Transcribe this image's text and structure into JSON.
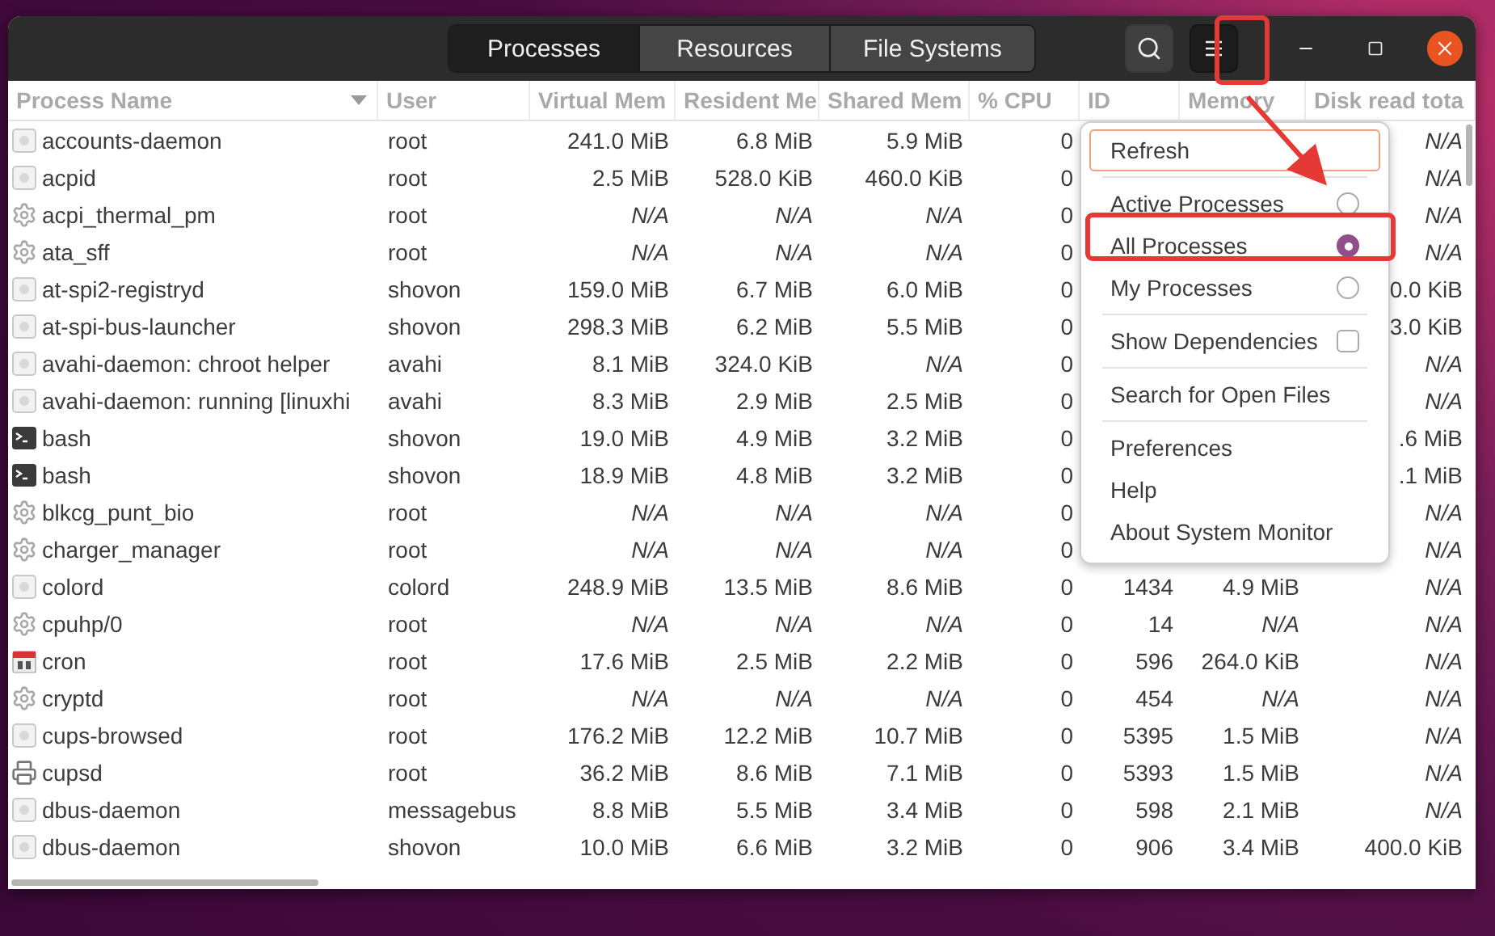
{
  "tabs": [
    {
      "label": "Processes",
      "selected": true
    },
    {
      "label": "Resources",
      "selected": false
    },
    {
      "label": "File Systems",
      "selected": false
    }
  ],
  "header_buttons": [
    {
      "kind": "search",
      "active": false
    },
    {
      "kind": "menu",
      "active": true
    }
  ],
  "columns": [
    {
      "label": "Process Name",
      "sorted": true
    },
    {
      "label": "User",
      "sorted": false
    },
    {
      "label": "Virtual Mem",
      "sorted": false
    },
    {
      "label": "Resident Me",
      "sorted": false
    },
    {
      "label": "Shared Mem",
      "sorted": false
    },
    {
      "label": "% CPU",
      "sorted": false
    },
    {
      "label": "ID",
      "sorted": false
    },
    {
      "label": "Memory",
      "sorted": false
    },
    {
      "label": "Disk read tota",
      "sorted": false
    }
  ],
  "rows": [
    {
      "kind": "generic",
      "name": "accounts-daemon",
      "user": "root",
      "values": [
        {
          "text": "241.0 MiB",
          "italic": false
        },
        {
          "text": "6.8 MiB",
          "italic": false
        },
        {
          "text": "5.9 MiB",
          "italic": false
        },
        {
          "text": "0",
          "italic": false
        }
      ],
      "disk_read": {
        "text": "N/A",
        "italic": true
      }
    },
    {
      "kind": "generic",
      "name": "acpid",
      "user": "root",
      "values": [
        {
          "text": "2.5 MiB",
          "italic": false
        },
        {
          "text": "528.0 KiB",
          "italic": false
        },
        {
          "text": "460.0 KiB",
          "italic": false
        },
        {
          "text": "0",
          "italic": false
        }
      ],
      "disk_read": {
        "text": "N/A",
        "italic": true
      }
    },
    {
      "kind": "gear",
      "name": "acpi_thermal_pm",
      "user": "root",
      "values": [
        {
          "text": "N/A",
          "italic": true
        },
        {
          "text": "N/A",
          "italic": true
        },
        {
          "text": "N/A",
          "italic": true
        },
        {
          "text": "0",
          "italic": false
        }
      ],
      "disk_read": {
        "text": "N/A",
        "italic": true
      }
    },
    {
      "kind": "gear",
      "name": "ata_sff",
      "user": "root",
      "values": [
        {
          "text": "N/A",
          "italic": true
        },
        {
          "text": "N/A",
          "italic": true
        },
        {
          "text": "N/A",
          "italic": true
        },
        {
          "text": "0",
          "italic": false
        }
      ],
      "disk_read": {
        "text": "N/A",
        "italic": true
      }
    },
    {
      "kind": "generic",
      "name": "at-spi2-registryd",
      "user": "shovon",
      "values": [
        {
          "text": "159.0 MiB",
          "italic": false
        },
        {
          "text": "6.7 MiB",
          "italic": false
        },
        {
          "text": "6.0 MiB",
          "italic": false
        },
        {
          "text": "0",
          "italic": false
        }
      ],
      "disk_read": {
        "text": "0.0 KiB",
        "italic": false
      }
    },
    {
      "kind": "generic",
      "name": "at-spi-bus-launcher",
      "user": "shovon",
      "values": [
        {
          "text": "298.3 MiB",
          "italic": false
        },
        {
          "text": "6.2 MiB",
          "italic": false
        },
        {
          "text": "5.5 MiB",
          "italic": false
        },
        {
          "text": "0",
          "italic": false
        }
      ],
      "disk_read": {
        "text": "3.0 KiB",
        "italic": false
      }
    },
    {
      "kind": "generic",
      "name": "avahi-daemon: chroot helper",
      "user": "avahi",
      "values": [
        {
          "text": "8.1 MiB",
          "italic": false
        },
        {
          "text": "324.0 KiB",
          "italic": false
        },
        {
          "text": "N/A",
          "italic": true
        },
        {
          "text": "0",
          "italic": false
        }
      ],
      "disk_read": {
        "text": "N/A",
        "italic": true
      }
    },
    {
      "kind": "generic",
      "name": "avahi-daemon: running [linuxhi",
      "user": "avahi",
      "values": [
        {
          "text": "8.3 MiB",
          "italic": false
        },
        {
          "text": "2.9 MiB",
          "italic": false
        },
        {
          "text": "2.5 MiB",
          "italic": false
        },
        {
          "text": "0",
          "italic": false
        }
      ],
      "disk_read": {
        "text": "N/A",
        "italic": true
      }
    },
    {
      "kind": "terminal",
      "name": "bash",
      "user": "shovon",
      "values": [
        {
          "text": "19.0 MiB",
          "italic": false
        },
        {
          "text": "4.9 MiB",
          "italic": false
        },
        {
          "text": "3.2 MiB",
          "italic": false
        },
        {
          "text": "0",
          "italic": false
        }
      ],
      "disk_read": {
        "text": ".6 MiB",
        "italic": false
      }
    },
    {
      "kind": "terminal",
      "name": "bash",
      "user": "shovon",
      "values": [
        {
          "text": "18.9 MiB",
          "italic": false
        },
        {
          "text": "4.8 MiB",
          "italic": false
        },
        {
          "text": "3.2 MiB",
          "italic": false
        },
        {
          "text": "0",
          "italic": false
        }
      ],
      "disk_read": {
        "text": ".1 MiB",
        "italic": false
      }
    },
    {
      "kind": "gear",
      "name": "blkcg_punt_bio",
      "user": "root",
      "values": [
        {
          "text": "N/A",
          "italic": true
        },
        {
          "text": "N/A",
          "italic": true
        },
        {
          "text": "N/A",
          "italic": true
        },
        {
          "text": "0",
          "italic": false
        }
      ],
      "disk_read": {
        "text": "N/A",
        "italic": true
      }
    },
    {
      "kind": "gear",
      "name": "charger_manager",
      "user": "root",
      "values": [
        {
          "text": "N/A",
          "italic": true
        },
        {
          "text": "N/A",
          "italic": true
        },
        {
          "text": "N/A",
          "italic": true
        },
        {
          "text": "0",
          "italic": false
        }
      ],
      "disk_read": {
        "text": "N/A",
        "italic": true
      }
    },
    {
      "kind": "generic",
      "name": "colord",
      "user": "colord",
      "values": [
        {
          "text": "248.9 MiB",
          "italic": false
        },
        {
          "text": "13.5 MiB",
          "italic": false
        },
        {
          "text": "8.6 MiB",
          "italic": false
        },
        {
          "text": "0",
          "italic": false
        },
        {
          "text": "1434",
          "italic": false
        },
        {
          "text": "4.9 MiB",
          "italic": false
        }
      ],
      "disk_read": {
        "text": "N/A",
        "italic": true
      }
    },
    {
      "kind": "gear",
      "name": "cpuhp/0",
      "user": "root",
      "values": [
        {
          "text": "N/A",
          "italic": true
        },
        {
          "text": "N/A",
          "italic": true
        },
        {
          "text": "N/A",
          "italic": true
        },
        {
          "text": "0",
          "italic": false
        },
        {
          "text": "14",
          "italic": false
        },
        {
          "text": "N/A",
          "italic": true
        }
      ],
      "disk_read": {
        "text": "N/A",
        "italic": true
      }
    },
    {
      "kind": "calendar",
      "name": "cron",
      "user": "root",
      "values": [
        {
          "text": "17.6 MiB",
          "italic": false
        },
        {
          "text": "2.5 MiB",
          "italic": false
        },
        {
          "text": "2.2 MiB",
          "italic": false
        },
        {
          "text": "0",
          "italic": false
        },
        {
          "text": "596",
          "italic": false
        },
        {
          "text": "264.0 KiB",
          "italic": false
        }
      ],
      "disk_read": {
        "text": "N/A",
        "italic": true
      }
    },
    {
      "kind": "gear",
      "name": "cryptd",
      "user": "root",
      "values": [
        {
          "text": "N/A",
          "italic": true
        },
        {
          "text": "N/A",
          "italic": true
        },
        {
          "text": "N/A",
          "italic": true
        },
        {
          "text": "0",
          "italic": false
        },
        {
          "text": "454",
          "italic": false
        },
        {
          "text": "N/A",
          "italic": true
        }
      ],
      "disk_read": {
        "text": "N/A",
        "italic": true
      }
    },
    {
      "kind": "generic",
      "name": "cups-browsed",
      "user": "root",
      "values": [
        {
          "text": "176.2 MiB",
          "italic": false
        },
        {
          "text": "12.2 MiB",
          "italic": false
        },
        {
          "text": "10.7 MiB",
          "italic": false
        },
        {
          "text": "0",
          "italic": false
        },
        {
          "text": "5395",
          "italic": false
        },
        {
          "text": "1.5 MiB",
          "italic": false
        }
      ],
      "disk_read": {
        "text": "N/A",
        "italic": true
      }
    },
    {
      "kind": "printer",
      "name": "cupsd",
      "user": "root",
      "values": [
        {
          "text": "36.2 MiB",
          "italic": false
        },
        {
          "text": "8.6 MiB",
          "italic": false
        },
        {
          "text": "7.1 MiB",
          "italic": false
        },
        {
          "text": "0",
          "italic": false
        },
        {
          "text": "5393",
          "italic": false
        },
        {
          "text": "1.5 MiB",
          "italic": false
        }
      ],
      "disk_read": {
        "text": "N/A",
        "italic": true
      }
    },
    {
      "kind": "generic",
      "name": "dbus-daemon",
      "user": "messagebus",
      "values": [
        {
          "text": "8.8 MiB",
          "italic": false
        },
        {
          "text": "5.5 MiB",
          "italic": false
        },
        {
          "text": "3.4 MiB",
          "italic": false
        },
        {
          "text": "0",
          "italic": false
        },
        {
          "text": "598",
          "italic": false
        },
        {
          "text": "2.1 MiB",
          "italic": false
        }
      ],
      "disk_read": {
        "text": "N/A",
        "italic": true
      }
    },
    {
      "kind": "generic",
      "name": "dbus-daemon",
      "user": "shovon",
      "values": [
        {
          "text": "10.0 MiB",
          "italic": false
        },
        {
          "text": "6.6 MiB",
          "italic": false
        },
        {
          "text": "3.2 MiB",
          "italic": false
        },
        {
          "text": "0",
          "italic": false
        },
        {
          "text": "906",
          "italic": false
        },
        {
          "text": "3.4 MiB",
          "italic": false
        }
      ],
      "disk_read": {
        "text": "400.0 KiB",
        "italic": false
      }
    }
  ],
  "menu": [
    {
      "kind": "button",
      "label": "Refresh",
      "focused": true
    },
    {
      "kind": "separator"
    },
    {
      "kind": "radio",
      "label": "Active Processes",
      "selected": false
    },
    {
      "kind": "radio",
      "label": "All Processes",
      "selected": true
    },
    {
      "kind": "radio",
      "label": "My Processes",
      "selected": false
    },
    {
      "kind": "separator"
    },
    {
      "kind": "check",
      "label": "Show Dependencies",
      "checked": false
    },
    {
      "kind": "separator"
    },
    {
      "kind": "action",
      "label": "Search for Open Files"
    },
    {
      "kind": "separator"
    },
    {
      "kind": "action",
      "label": "Preferences"
    },
    {
      "kind": "action",
      "label": "Help"
    },
    {
      "kind": "action",
      "label": "About System Monitor"
    }
  ]
}
